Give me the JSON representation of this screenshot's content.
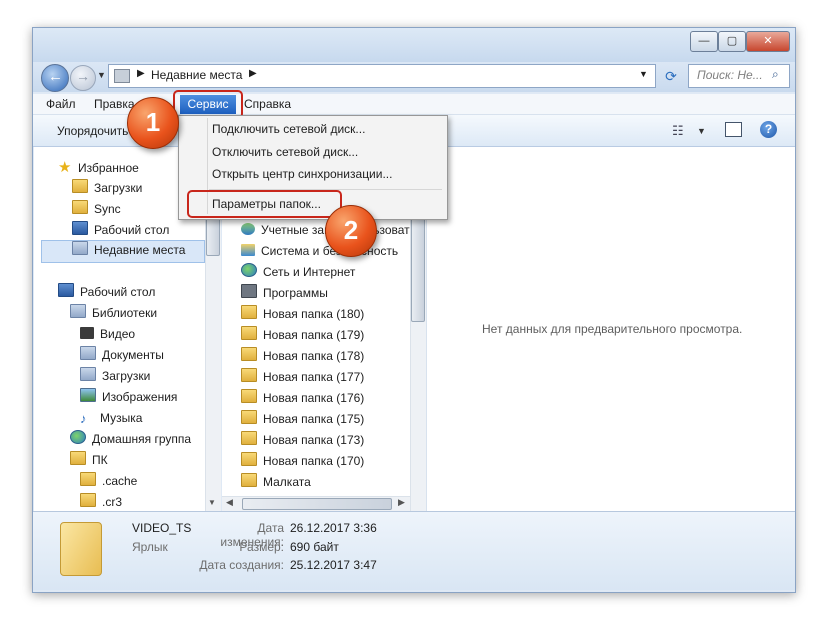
{
  "window": {
    "address": "Недавние места",
    "search_placeholder": "Поиск: Не...",
    "min": "—",
    "max": "▢",
    "close": "✕"
  },
  "menu": {
    "file": "Файл",
    "edit": "Правка",
    "tools": "Сервис",
    "help": "Справка"
  },
  "toolbar": {
    "organize": "Упорядочить"
  },
  "dropdown": {
    "map_drive": "Подключить сетевой диск...",
    "disconnect_drive": "Отключить сетевой диск...",
    "sync_center": "Открыть центр синхронизации...",
    "folder_options": "Параметры папок..."
  },
  "badges": {
    "one": "1",
    "two": "2"
  },
  "nav": {
    "favorites": "Избранное",
    "downloads": "Загрузки",
    "sync": "Sync",
    "desktop": "Рабочий стол",
    "recent": "Недавние места",
    "desktop2": "Рабочий стол",
    "libraries": "Библиотеки",
    "video": "Видео",
    "documents": "Документы",
    "downloads2": "Загрузки",
    "images": "Изображения",
    "music": "Музыка",
    "homegroup": "Домашняя группа",
    "pc": "ПК",
    "cache": ".cache",
    "cr3": ".cr3"
  },
  "files": [
    "Учетные записи пользоват",
    "Система и безопасность",
    "Сеть и Интернет",
    "Программы",
    "Новая папка (180)",
    "Новая папка (179)",
    "Новая папка (178)",
    "Новая папка (177)",
    "Новая папка (176)",
    "Новая папка (175)",
    "Новая папка (173)",
    "Новая папка (170)",
    "Малката"
  ],
  "preview": {
    "empty": "Нет данных для предварительного просмотра."
  },
  "details": {
    "name": "VIDEO_TS",
    "type": "Ярлык",
    "modified_label": "Дата изменения:",
    "modified_value": "26.12.2017 3:36",
    "size_label": "Размер:",
    "size_value": "690 байт",
    "created_label": "Дата создания:",
    "created_value": "25.12.2017 3:47"
  }
}
